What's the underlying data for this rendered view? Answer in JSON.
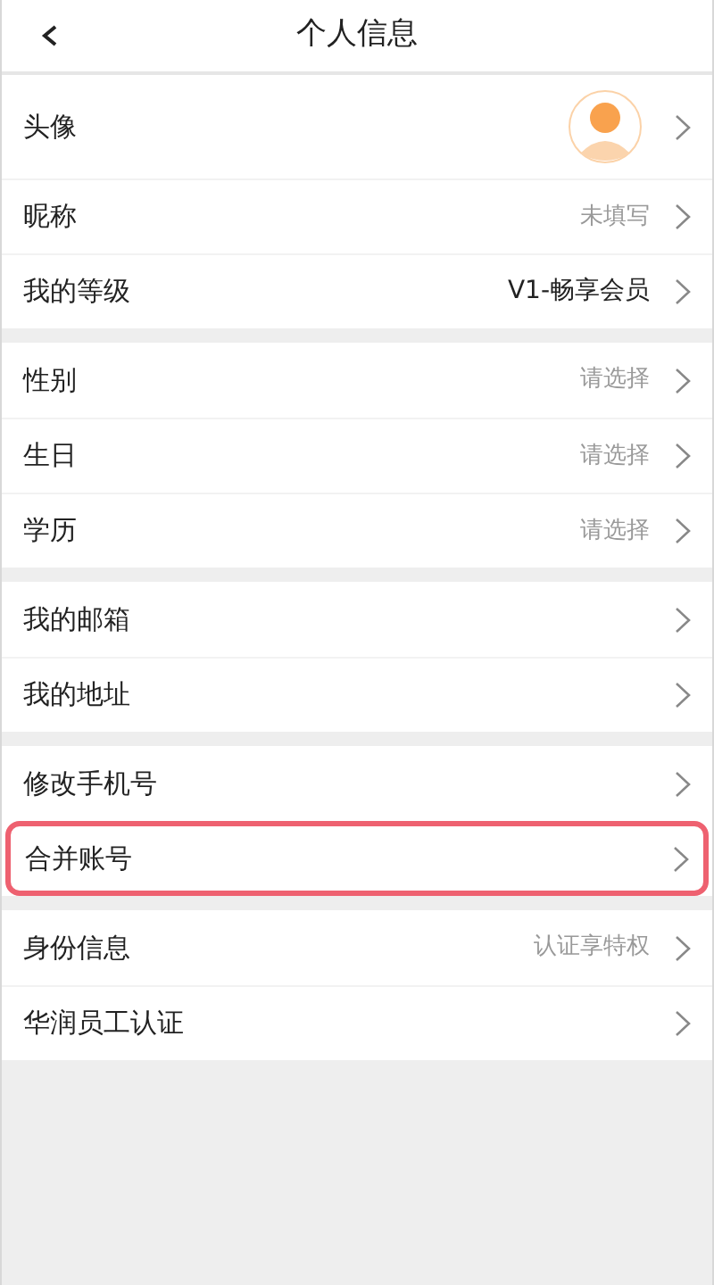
{
  "header": {
    "title": "个人信息"
  },
  "groups": [
    {
      "rows": [
        {
          "kind": "avatar",
          "label": "头像",
          "highlighted": false
        },
        {
          "kind": "text",
          "label": "昵称",
          "value": "未填写",
          "highlighted": false
        },
        {
          "kind": "text",
          "label": "我的等级",
          "value": "V1-畅享会员",
          "value_strong": true,
          "highlighted": false
        }
      ]
    },
    {
      "rows": [
        {
          "kind": "text",
          "label": "性别",
          "value": "请选择",
          "highlighted": false
        },
        {
          "kind": "text",
          "label": "生日",
          "value": "请选择",
          "highlighted": false
        },
        {
          "kind": "text",
          "label": "学历",
          "value": "请选择",
          "highlighted": false
        }
      ]
    },
    {
      "rows": [
        {
          "kind": "text",
          "label": "我的邮箱",
          "highlighted": false
        },
        {
          "kind": "text",
          "label": "我的地址",
          "highlighted": false
        }
      ]
    },
    {
      "rows": [
        {
          "kind": "text",
          "label": "修改手机号",
          "highlighted": false
        },
        {
          "kind": "text",
          "label": "合并账号",
          "highlighted": true
        }
      ]
    },
    {
      "rows": [
        {
          "kind": "text",
          "label": "身份信息",
          "value": "认证享特权",
          "highlighted": false
        },
        {
          "kind": "text",
          "label": "华润员工认证",
          "highlighted": false
        }
      ]
    }
  ]
}
